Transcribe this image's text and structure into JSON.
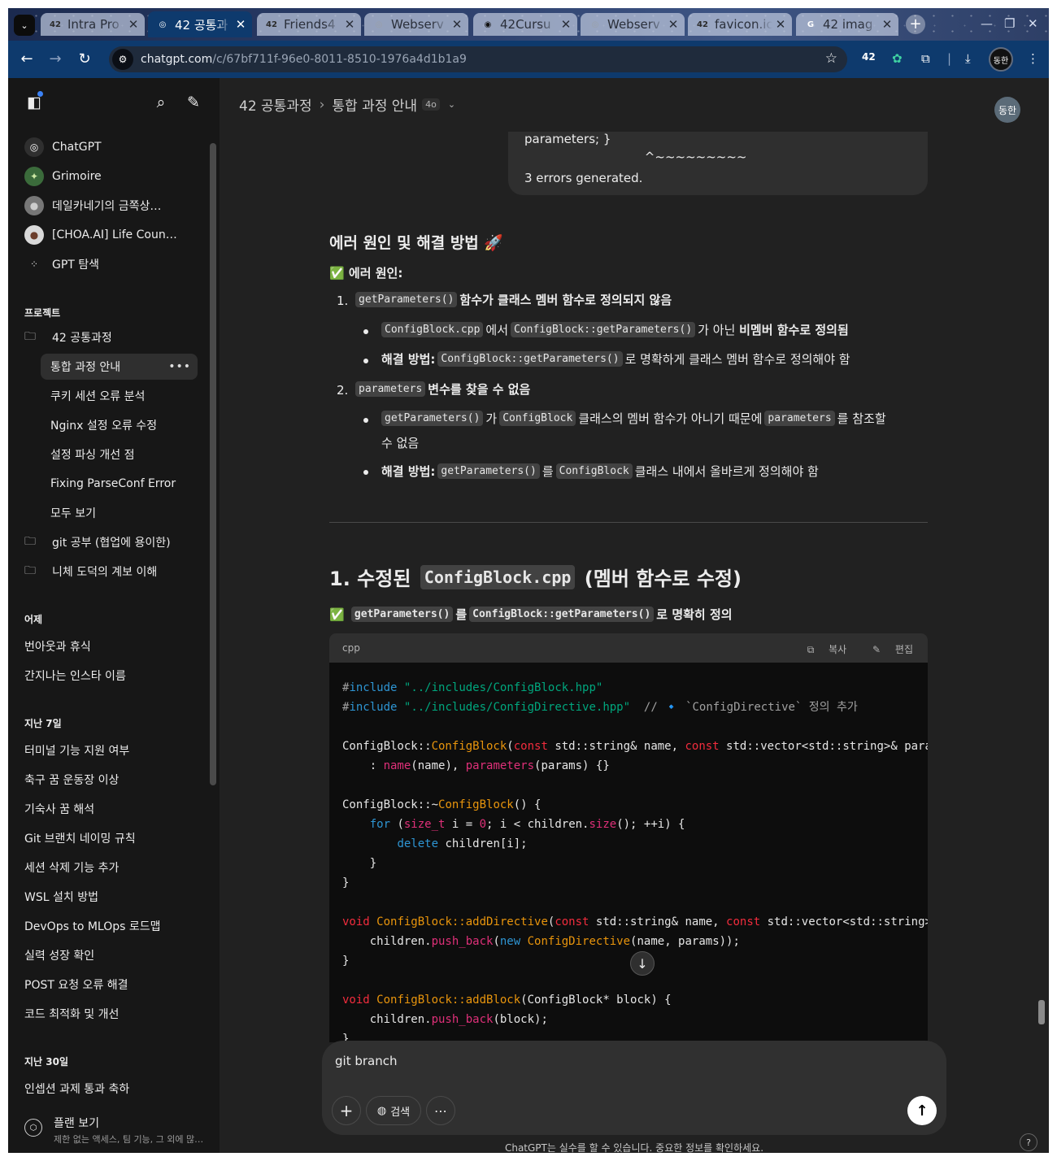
{
  "browser": {
    "tabs": [
      {
        "title": "Intra Pro",
        "fav": "42",
        "favColor": "#2b2b2b"
      },
      {
        "title": "42 공통과",
        "fav": "◎",
        "favColor": "#ffffff"
      },
      {
        "title": "Friends4",
        "fav": "42",
        "favColor": "#2b2b2b"
      },
      {
        "title": "Webserv",
        "fav": "◎",
        "favColor": "#9aa0a8"
      },
      {
        "title": "42Cursu",
        "fav": "◉",
        "favColor": "#111111"
      },
      {
        "title": "Webserv",
        "fav": "◎",
        "favColor": "#9aa0a8"
      },
      {
        "title": "favicon.ic",
        "fav": "42",
        "favColor": "#2b2b2b"
      },
      {
        "title": "42 imag",
        "fav": "G",
        "favColor": "#ffffff"
      }
    ],
    "url_host": "chatgpt.com",
    "url_path": "/c/67bf711f-96e0-8011-8510-1976a4d1b1a9",
    "profile_label": "동한"
  },
  "sidebar": {
    "gpts": [
      {
        "label": "ChatGPT",
        "icon": "openai-icon"
      },
      {
        "label": "Grimoire",
        "icon": "grimoire-avatar"
      },
      {
        "label": "데일카네기의 금쪽상…",
        "icon": "carnegie-avatar"
      },
      {
        "label": "[CHOA.AI] Life Coun…",
        "icon": "choa-avatar"
      },
      {
        "label": "GPT 탐색",
        "icon": "grid-icon"
      }
    ],
    "projects_heading": "프로젝트",
    "projects": [
      {
        "label": "42 공통과정"
      },
      {
        "label": "통합 과정 안내"
      },
      {
        "label": "쿠키 세션 오류 분석"
      },
      {
        "label": "Nginx 설정 오류 수정"
      },
      {
        "label": "설정 파싱 개선 점"
      },
      {
        "label": "Fixing ParseConf Error"
      },
      {
        "label": "모두 보기"
      },
      {
        "label": "git 공부 (협업에 용이한)"
      },
      {
        "label": "니체 도덕의 계보 이해"
      }
    ],
    "yesterday_heading": "어제",
    "yesterday": [
      "번아웃과 휴식",
      "간지나는 인스타 이름"
    ],
    "week_heading": "지난 7일",
    "week": [
      "터미널 기능 지원 여부",
      "축구 꿈 운동장 이상",
      "기숙사 꿈 해석",
      "Git 브랜치 네이밍 규칙",
      "세션 삭제 기능 추가",
      "WSL 설치 방법",
      "DevOps to MLOps 로드맵",
      "실력 성장 확인",
      "POST 요청 오류 해결",
      "코드 최적화 및 개선"
    ],
    "month_heading": "지난 30일",
    "month": [
      "인셉션 과제 통과 축하"
    ],
    "plan_title": "플랜 보기",
    "plan_sub": "제한 없는 액세스, 팀 기능, 그 외에 많…"
  },
  "header": {
    "project": "42 공통과정",
    "chat": "통합 과정 안내",
    "model": "4o",
    "avatar": "동한"
  },
  "message": {
    "bubble_lines": [
      "parameters; }",
      "                               ^~~~~~~~~~",
      "3 errors generated."
    ],
    "section_title": "에러 원인 및 해결 방법 🚀",
    "cause_label": "✅ 에러 원인:",
    "item1_code": "getParameters()",
    "item1_text": "함수가 클래스 멤버 함수로 정의되지 않음",
    "item1_b1_code1": "ConfigBlock.cpp",
    "item1_b1_mid": "에서",
    "item1_b1_code2": "ConfigBlock::getParameters()",
    "item1_b1_mid2": "가 아닌",
    "item1_b1_bold": "비멤버 함수로 정의됨",
    "fix_label": "해결 방법:",
    "item1_b2_code": "ConfigBlock::getParameters()",
    "item1_b2_text": "로 명확하게 클래스 멤버 함수로 정의해야 함",
    "item2_code": "parameters",
    "item2_text": "변수를 찾을 수 없음",
    "item2_b1_code1": "getParameters()",
    "item2_b1_mid": "가",
    "item2_b1_code2": "ConfigBlock",
    "item2_b1_mid2": "클래스의 멤버 함수가 아니기 때문에",
    "item2_b1_code3": "parameters",
    "item2_b1_tail": "를 참조할",
    "item2_b1_tail2": "수 없음",
    "item2_b2_code1": "getParameters()",
    "item2_b2_mid": "를",
    "item2_b2_code2": "ConfigBlock",
    "item2_b2_text": "클래스 내에서 올바르게 정의해야 함",
    "h2_prefix": "1. 수정된",
    "h2_code": "ConfigBlock.cpp",
    "h2_suffix": "(멤버 함수로 수정)",
    "note_check": "✅",
    "note_code1": "getParameters()",
    "note_mid": "를",
    "note_code2": "ConfigBlock::getParameters()",
    "note_text": "로 명확히 정의",
    "code_lang": "cpp",
    "copy_label": "복사",
    "edit_label": "편집"
  },
  "composer": {
    "value": "git branch",
    "search_label": "검색",
    "disclaimer": "ChatGPT는 실수를 할 수 있습니다. 중요한 정보를 확인하세요."
  }
}
